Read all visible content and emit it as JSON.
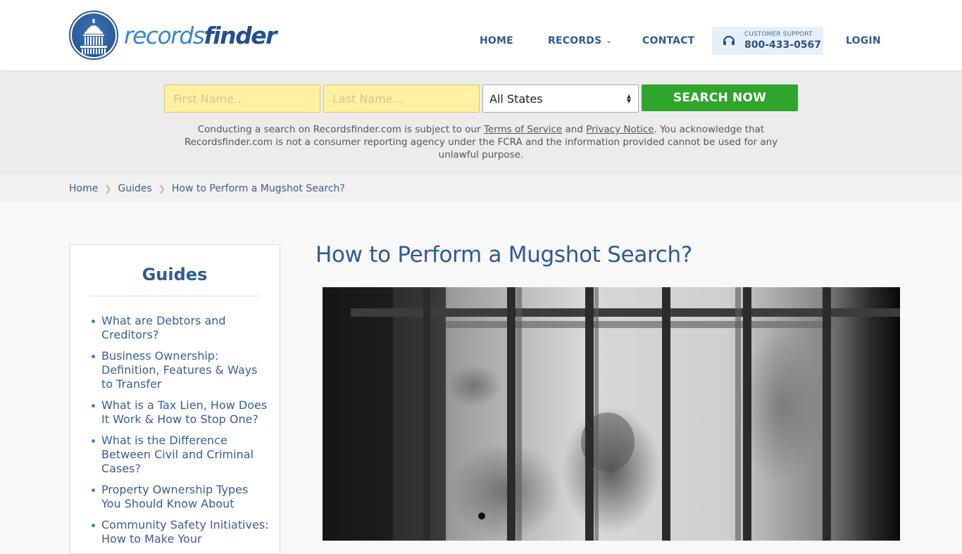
{
  "header": {
    "logo": {
      "light": "records",
      "bold": "finder",
      "icon": "capitol-dome-icon"
    },
    "nav": [
      {
        "label": "HOME"
      },
      {
        "label": "RECORDS",
        "icon": "chevron-down-icon"
      },
      {
        "label": "CONTACT"
      },
      {
        "label": "LOGIN"
      }
    ],
    "support": {
      "icon": "headset-icon",
      "label": "CUSTOMER SUPPORT",
      "phone": "800-433-0567"
    }
  },
  "search": {
    "first_name_placeholder": "First Name...",
    "last_name_placeholder": "Last Name...",
    "first_name_value": "",
    "last_name_value": "",
    "state_selected": "All States",
    "button_label": "SEARCH NOW",
    "disclaimer": {
      "part1": "Conducting a search on Recordsfinder.com is subject to our ",
      "terms_link": "Terms of Service",
      "part2": " and ",
      "privacy_link": "Privacy Notice",
      "part3": ". You acknowledge that Recordsfinder.com is not a consumer reporting agency under the FCRA and the information provided cannot be used for any unlawful purpose."
    }
  },
  "breadcrumb": [
    {
      "label": "Home"
    },
    {
      "label": "Guides"
    },
    {
      "label": "How to Perform a Mugshot Search?"
    }
  ],
  "sidebar": {
    "title": "Guides",
    "items": [
      {
        "label": "What are Debtors and Creditors?"
      },
      {
        "label": "Business Ownership: Definition, Features & Ways to Transfer"
      },
      {
        "label": "What is a Tax Lien, How Does It Work & How to Stop One?"
      },
      {
        "label": "What is the Difference Between Civil and Criminal Cases?"
      },
      {
        "label": "Property Ownership Types You Should Know About"
      },
      {
        "label": "Community Safety Initiatives: How to Make Your"
      }
    ]
  },
  "article": {
    "title": "How to Perform a Mugshot Search?",
    "hero_image": "jail-bars-shadow-photo"
  },
  "colors": {
    "brand_blue": "#2e5c94",
    "search_green": "#2ea52b",
    "input_yellow": "#fff1a0",
    "support_bg": "#e6f0fb"
  }
}
